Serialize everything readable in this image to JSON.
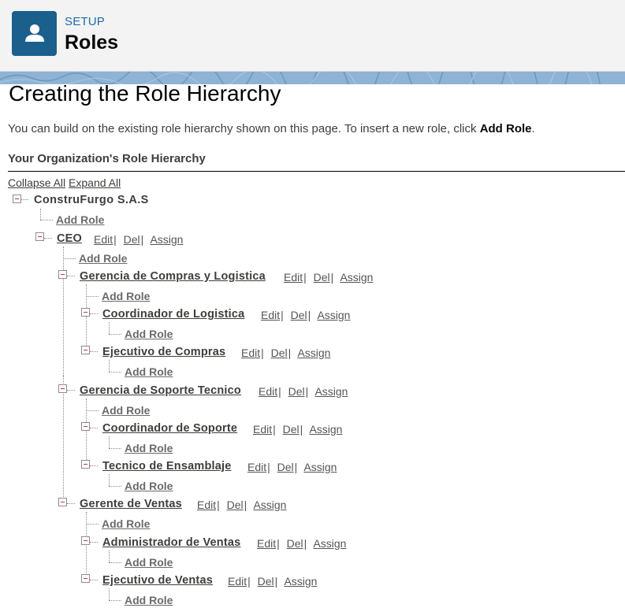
{
  "header": {
    "eyebrow": "SETUP",
    "title": "Roles",
    "icon": "user-icon",
    "icon_color": "#1b5f8c"
  },
  "page": {
    "title": "Creating the Role Hierarchy",
    "intro_text": "You can build on the existing role hierarchy shown on this page. To insert a new role, click ",
    "intro_bold": "Add Role",
    "intro_end": ".",
    "section_title": "Your Organization's Role Hierarchy",
    "collapse_all": "Collapse All",
    "expand_all": "Expand All"
  },
  "labels": {
    "add_role": "Add Role",
    "edit": "Edit",
    "del": "Del",
    "assign": "Assign",
    "separator": "|"
  },
  "tree": {
    "root": "ConstruFurgo S.A.S",
    "ceo": "CEO",
    "gerencia_compras": "Gerencia de Compras y Logistica",
    "coord_logistica": "Coordinador de Logistica",
    "ejec_compras": "Ejecutivo de Compras",
    "gerencia_soporte": "Gerencia de Soporte Tecnico",
    "coord_soporte": "Coordinador de Soporte",
    "tecnico_ensamblaje": "Tecnico de Ensamblaje",
    "gerente_ventas": "Gerente de Ventas",
    "admin_ventas": "Administrador de Ventas",
    "ejec_ventas": "Ejecutivo de Ventas"
  }
}
